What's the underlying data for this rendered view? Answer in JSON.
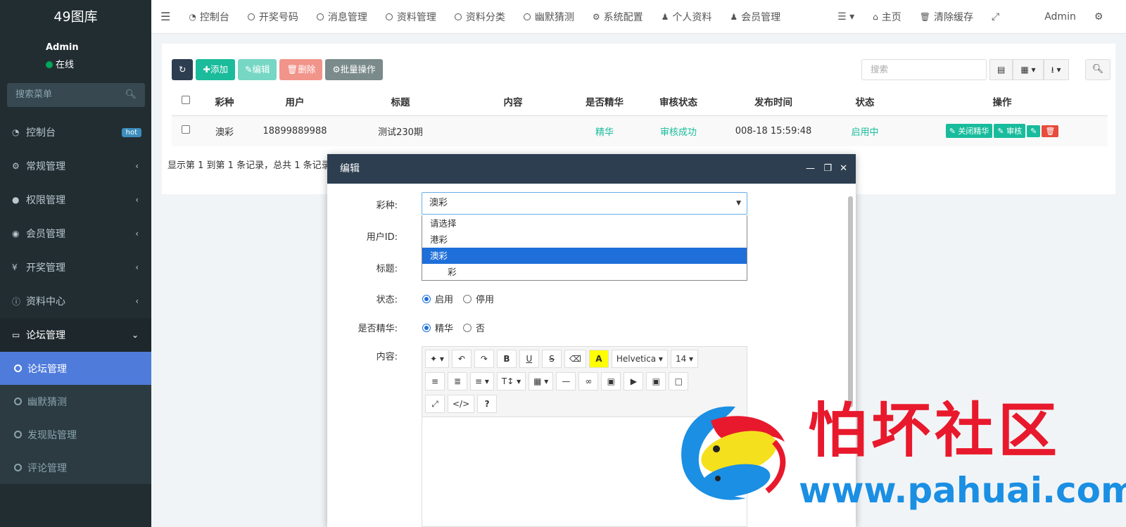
{
  "sidebar": {
    "logo": "49图库",
    "user_name": "Admin",
    "user_status": "在线",
    "search_placeholder": "搜索菜单",
    "items": [
      {
        "label": "控制台",
        "icon": "dashboard-icon",
        "badge": "hot"
      },
      {
        "label": "常规管理",
        "icon": "cogs-icon"
      },
      {
        "label": "权限管理",
        "icon": "group-icon"
      },
      {
        "label": "会员管理",
        "icon": "user-circle-icon"
      },
      {
        "label": "开奖管理",
        "icon": "yen-icon"
      },
      {
        "label": "资料中心",
        "icon": "info-icon"
      },
      {
        "label": "论坛管理",
        "icon": "laptop-icon"
      }
    ],
    "sub_items": [
      "论坛管理",
      "幽默猜测",
      "发现贴管理",
      "评论管理"
    ]
  },
  "topnav": {
    "items": [
      "控制台",
      "开奖号码",
      "消息管理",
      "资料管理",
      "资料分类",
      "幽默猜测",
      "系统配置",
      "个人资料",
      "会员管理"
    ],
    "home": "主页",
    "clear_cache": "清除缓存",
    "admin": "Admin"
  },
  "toolbar": {
    "add": "添加",
    "edit": "编辑",
    "delete": "删除",
    "batch": "批量操作",
    "search_placeholder": "搜索"
  },
  "table": {
    "headers": [
      "彩种",
      "用户",
      "标题",
      "内容",
      "是否精华",
      "审核状态",
      "发布时间",
      "状态",
      "操作"
    ],
    "row": {
      "lottery": "澳彩",
      "user": "18899889988",
      "title": "测试230期",
      "content": "",
      "essence": "精华",
      "review": "审核成功",
      "time": "008-18 15:59:48",
      "status": "启用中",
      "actions": [
        "关闭精华",
        "审核"
      ]
    },
    "pager": "显示第 1 到第 1 条记录，总共 1 条记录"
  },
  "modal": {
    "title": "编辑",
    "labels": {
      "lottery": "彩种:",
      "user_id": "用户ID:",
      "title": "标题:",
      "status": "状态:",
      "essence": "是否精华:",
      "content": "内容:"
    },
    "select_value": "澳彩",
    "options": [
      "请选择",
      "港彩",
      "澳彩",
      "彩"
    ],
    "selected_index": 2,
    "status_options": [
      "启用",
      "停用"
    ],
    "essence_options": [
      "精华",
      "否"
    ],
    "editor": {
      "font": "Helvetica",
      "size": "14"
    }
  },
  "watermark": {
    "text": "怕坏社区",
    "url": "www.pahuai.com"
  }
}
